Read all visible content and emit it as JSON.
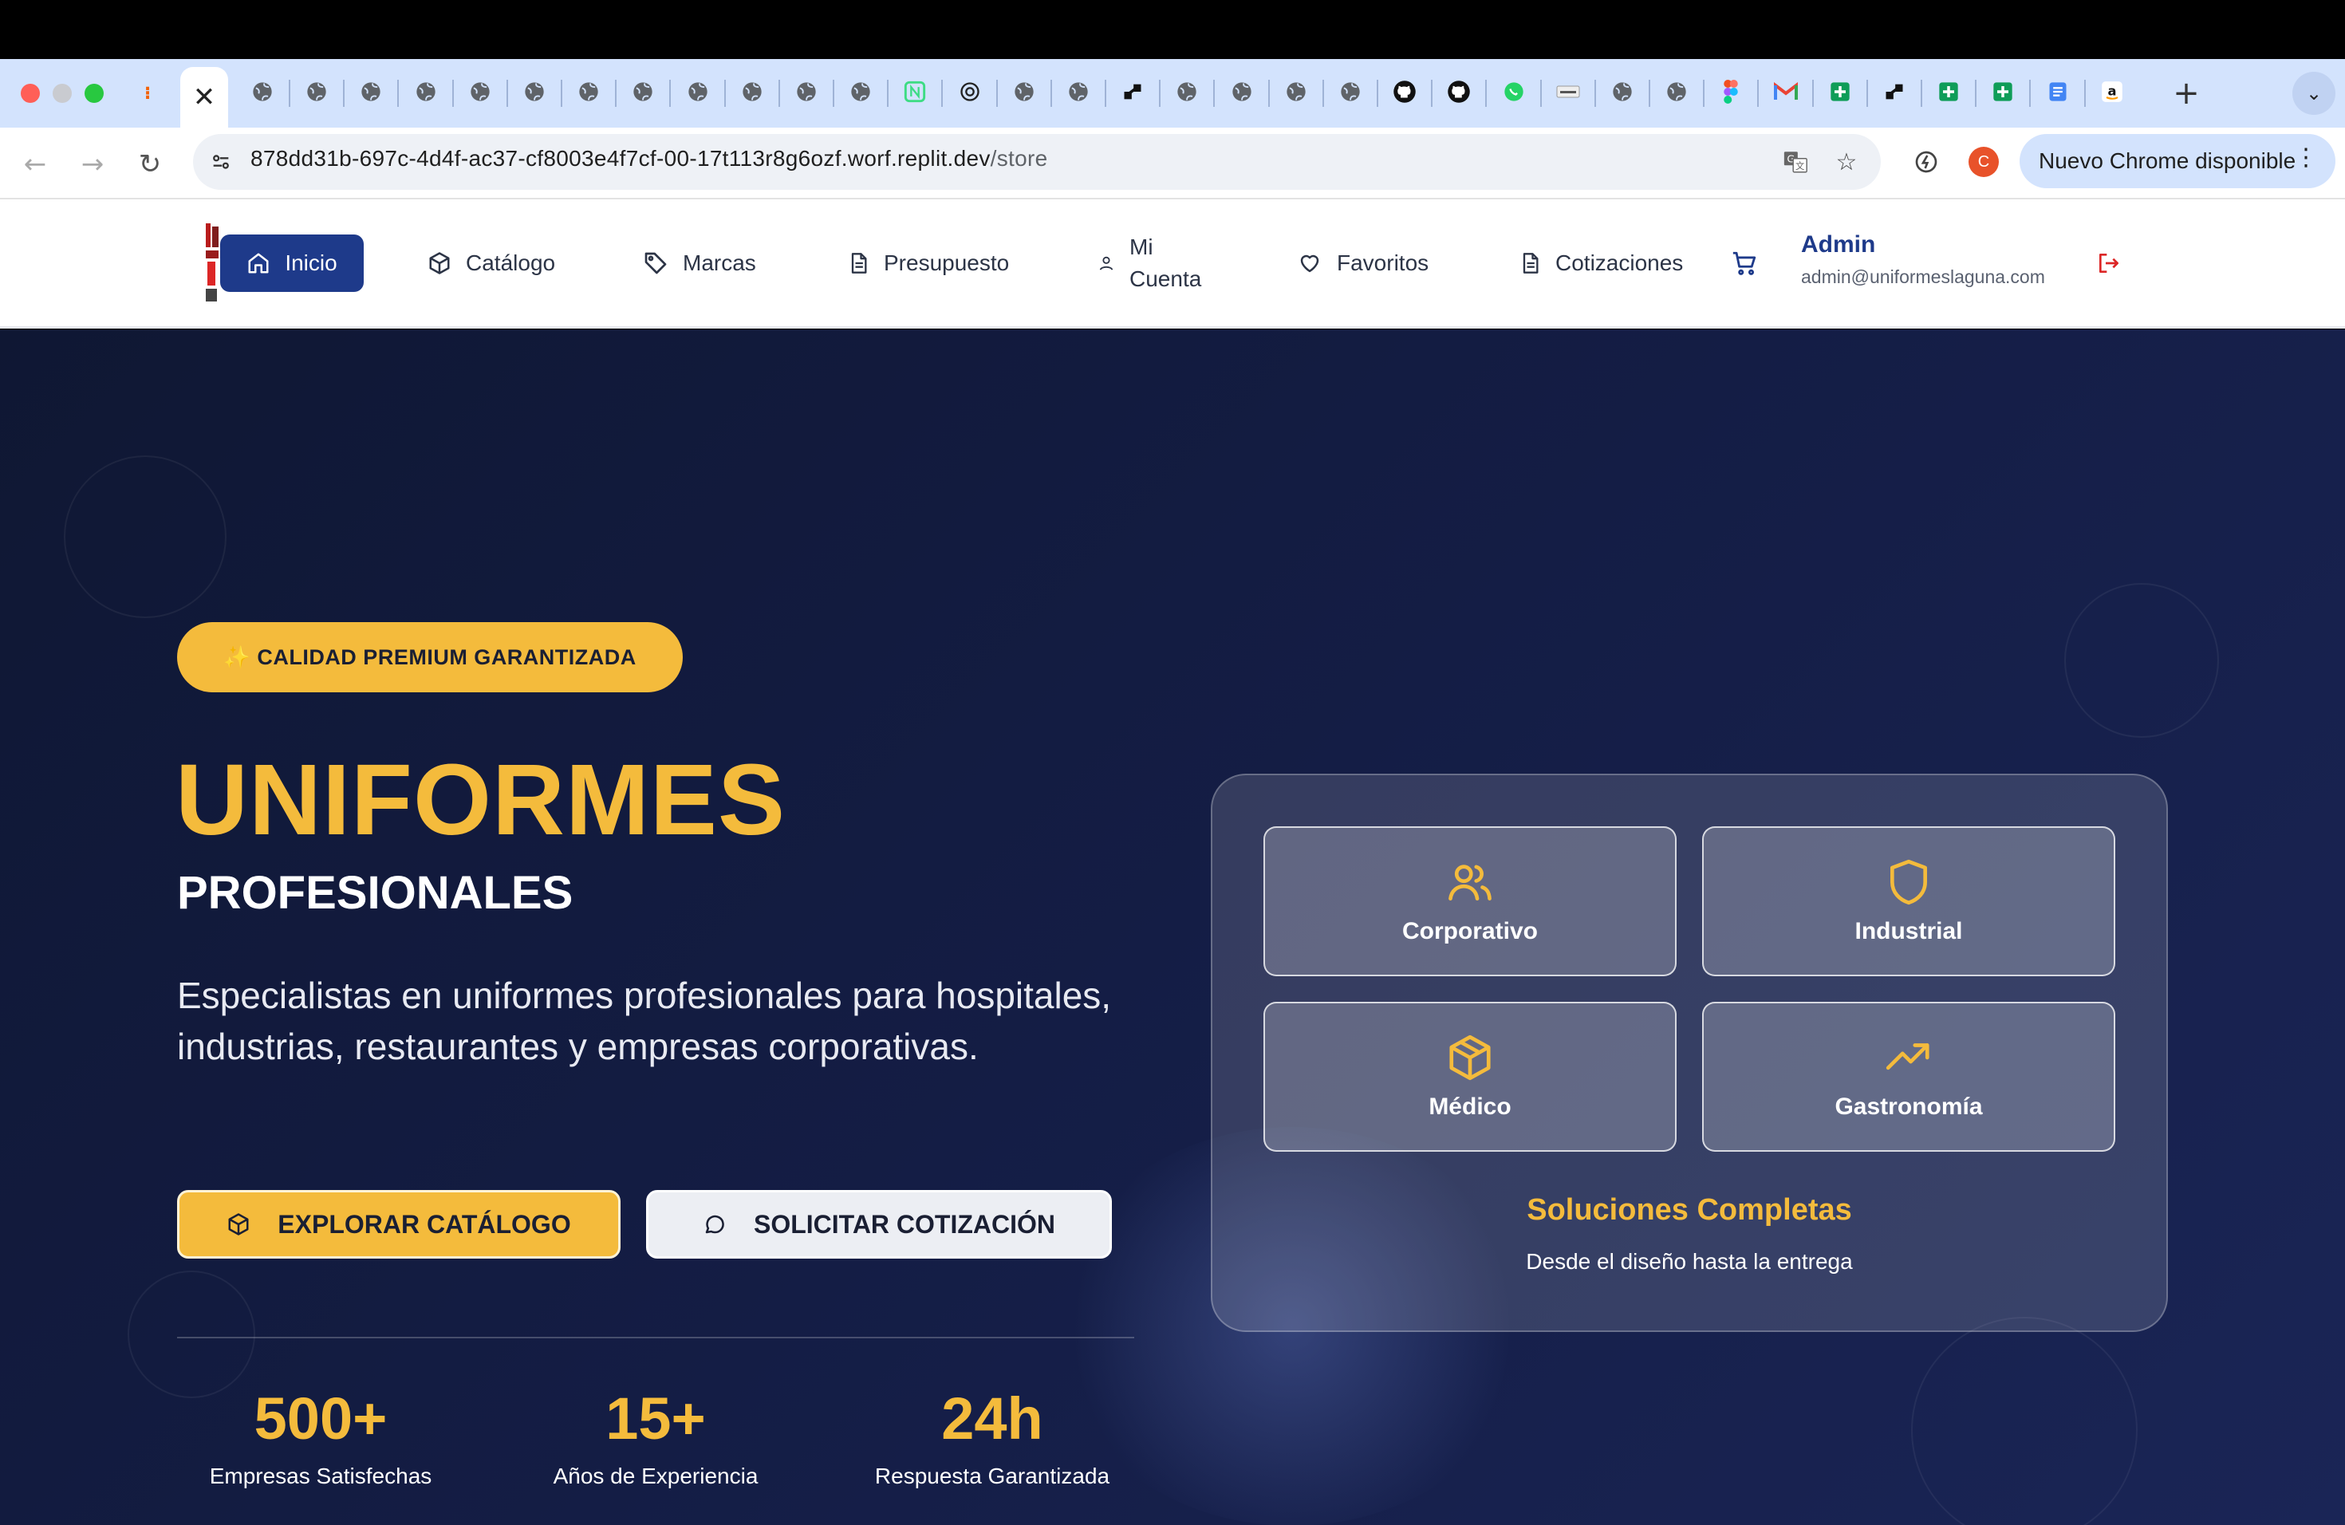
{
  "browser": {
    "url_host": "878dd31b-697c-4d4f-ac37-cf8003e4f7cf-00-17t113r8g6ozf.worf.replit.dev",
    "url_path": "/store",
    "update_button": "Nuevo Chrome disponible",
    "profile_initial": "C",
    "active_tab_close": "✕",
    "new_tab": "+"
  },
  "nav": {
    "home": "Inicio",
    "catalog": "Catálogo",
    "brands": "Marcas",
    "budget": "Presupuesto",
    "account_line1": "Mi",
    "account_line2": "Cuenta",
    "favorites": "Favoritos",
    "quotes": "Cotizaciones",
    "user_name": "Admin",
    "user_email": "admin@uniformeslaguna.com"
  },
  "hero": {
    "badge": "✨ CALIDAD PREMIUM GARANTIZADA",
    "title": "UNIFORMES",
    "subtitle": "PROFESIONALES",
    "description": "Especialistas en uniformes profesionales para hospitales, industrias, restaurantes y empresas corporativas.",
    "primary_button": "EXPLORAR CATÁLOGO",
    "secondary_button": "SOLICITAR COTIZACIÓN",
    "stats": [
      {
        "value": "500+",
        "label": "Empresas Satisfechas"
      },
      {
        "value": "15+",
        "label": "Años de Experiencia"
      },
      {
        "value": "24h",
        "label": "Respuesta Garantizada"
      }
    ]
  },
  "solutions": {
    "tiles": [
      {
        "label": "Corporativo",
        "icon": "users-icon"
      },
      {
        "label": "Industrial",
        "icon": "shield-icon"
      },
      {
        "label": "Médico",
        "icon": "package-icon"
      },
      {
        "label": "Gastronomía",
        "icon": "trending-up-icon"
      }
    ],
    "title": "Soluciones Completas",
    "subtitle": "Desde el diseño hasta la entrega"
  },
  "colors": {
    "accent": "#f4bb3c",
    "primary": "#1e3a8a",
    "hero_bg": "#141d45"
  }
}
